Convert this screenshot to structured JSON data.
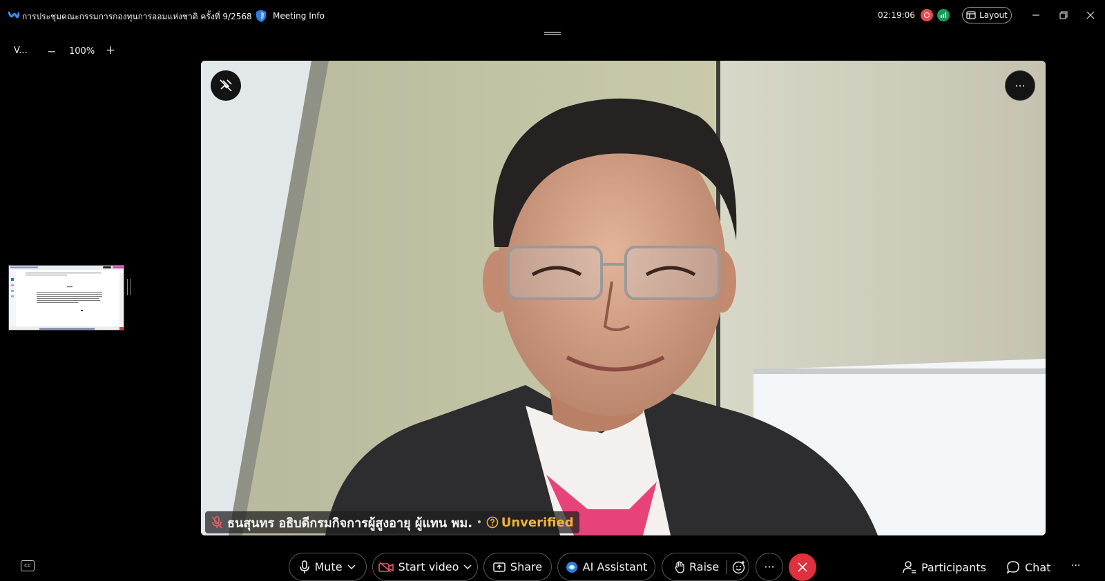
{
  "titlebar": {
    "meeting_title": "การประชุมคณะกรรมการกองทุนการออมแห่งชาติ ครั้งที่ 9/2568",
    "meeting_info_label": "Meeting Info",
    "timer": "02:19:06",
    "layout_label": "Layout",
    "icons": [
      "webex-logo-icon",
      "shield-icon",
      "recording-icon",
      "signal-icon",
      "layout-icon",
      "minimize-icon",
      "restore-icon",
      "close-icon"
    ]
  },
  "left_panel": {
    "view_label": "V...",
    "zoom_out": "−",
    "zoom_level": "100%",
    "zoom_in": "+"
  },
  "video": {
    "participant_name": "ธนสุนทร อธิบดีกรมกิจการผู้สูงอายุ ผู้แทน พม.",
    "separator": "•",
    "verification": "Unverified",
    "more_label": "···"
  },
  "toolbar": {
    "mute_label": "Mute",
    "start_video_label": "Start video",
    "share_label": "Share",
    "ai_assistant_label": "AI Assistant",
    "raise_label": "Raise",
    "more_label": "···",
    "participants_label": "Participants",
    "chat_label": "Chat",
    "overflow_label": "···",
    "cc_label": "CC"
  },
  "colors": {
    "background": "#000000",
    "end_call": "#e0303c",
    "recording": "#e8484f",
    "signal": "#1b9b5a",
    "unverified": "#f0b43c"
  }
}
